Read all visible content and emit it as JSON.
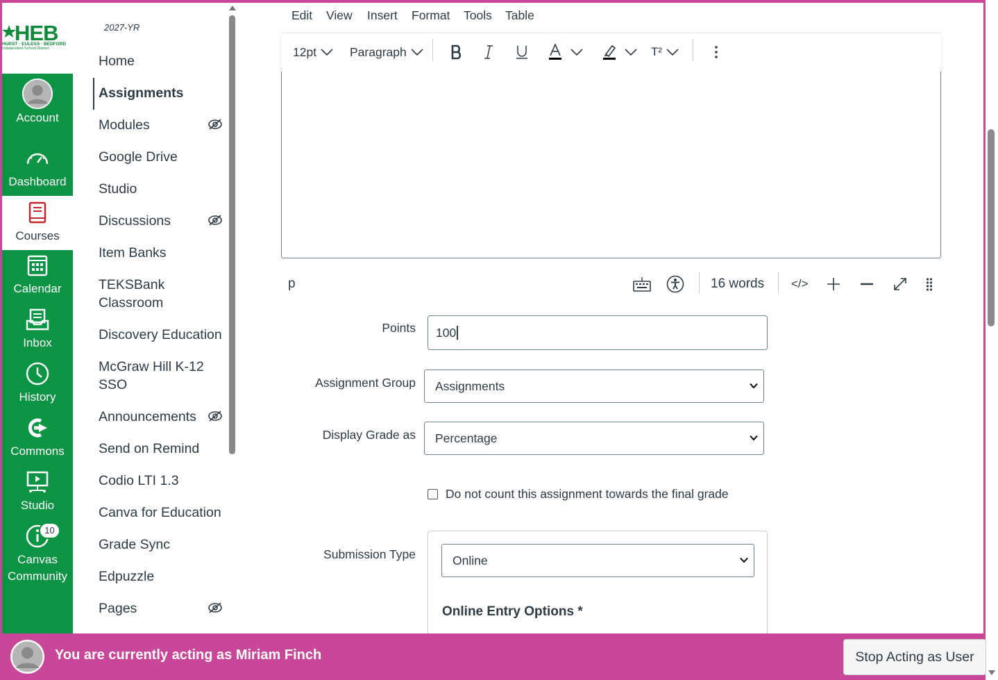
{
  "theme": {
    "brand_green": "#0b9444",
    "masquerade_pink": "#c94798",
    "text": "#2d3b45"
  },
  "logo": {
    "big": "HEB",
    "line1": "HURST · EULESS · BEDFORD",
    "line2": "Independent School District"
  },
  "global_nav": [
    {
      "label": "Account",
      "icon": "account-avatar-icon"
    },
    {
      "label": "Dashboard",
      "icon": "dashboard-gauge-icon"
    },
    {
      "label": "Courses",
      "icon": "courses-book-icon",
      "active": true
    },
    {
      "label": "Calendar",
      "icon": "calendar-icon"
    },
    {
      "label": "Inbox",
      "icon": "inbox-icon"
    },
    {
      "label": "History",
      "icon": "history-clock-icon"
    },
    {
      "label": "Commons",
      "icon": "commons-icon"
    },
    {
      "label": "Studio",
      "icon": "studio-icon"
    },
    {
      "label": "Canvas Community",
      "label1": "Canvas",
      "label2": "Community",
      "icon": "help-icon",
      "badge": "10"
    }
  ],
  "course_nav": {
    "term": "2027-YR",
    "items": [
      {
        "label": "Home"
      },
      {
        "label": "Assignments",
        "active": true
      },
      {
        "label": "Modules",
        "hidden_from_students": true
      },
      {
        "label": "Google Drive"
      },
      {
        "label": "Studio"
      },
      {
        "label": "Discussions",
        "hidden_from_students": true
      },
      {
        "label": "Item Banks"
      },
      {
        "label": "TEKSBank Classroom",
        "line1": "TEKSBank",
        "line2": "Classroom"
      },
      {
        "label": "Discovery Education"
      },
      {
        "label": "McGraw Hill K-12 SSO",
        "line1": "McGraw Hill K-12",
        "line2": "SSO"
      },
      {
        "label": "Announcements",
        "hidden_from_students": true
      },
      {
        "label": "Send on Remind"
      },
      {
        "label": "Codio LTI 1.3"
      },
      {
        "label": "Canva for Education"
      },
      {
        "label": "Grade Sync"
      },
      {
        "label": "Edpuzzle"
      },
      {
        "label": "Pages",
        "hidden_from_students": true
      }
    ]
  },
  "editor": {
    "menu": [
      "Edit",
      "View",
      "Insert",
      "Format",
      "Tools",
      "Table"
    ],
    "font_size": "12pt",
    "block_format": "Paragraph",
    "superscript_label": "T²",
    "status_path": "p",
    "word_count": "16 words",
    "html_toggle": "</>"
  },
  "form": {
    "points": {
      "label": "Points",
      "value": "100"
    },
    "assignment_group": {
      "label": "Assignment Group",
      "value": "Assignments"
    },
    "display_grade": {
      "label": "Display Grade as",
      "value": "Percentage"
    },
    "exclude_final": {
      "label": "Do not count this assignment towards the final grade",
      "checked": false
    },
    "submission_type": {
      "label": "Submission Type",
      "value": "Online"
    },
    "online_entry": {
      "heading": "Online Entry Options *"
    }
  },
  "masquerade": {
    "message": "You are currently acting as Miriam Finch",
    "stop_label": "Stop Acting as User"
  }
}
